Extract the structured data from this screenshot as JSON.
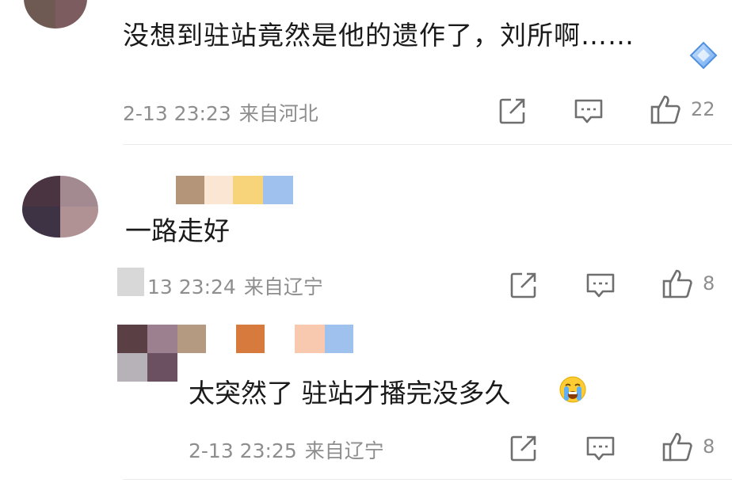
{
  "comments": [
    {
      "text": "没想到驻站竟然是他的遗作了，刘所啊……",
      "time": "2-13 23:23",
      "location": "来自河北",
      "likes": "22"
    },
    {
      "text": "一路走好",
      "time_visible": "13 23:24",
      "location": "来自辽宁",
      "likes": "8",
      "reply": {
        "text": "太突然了 驻站才播完没多久",
        "emoji": "crying-face",
        "time": "2-13 23:25",
        "location": "来自辽宁",
        "likes": "8"
      }
    }
  ],
  "icons": [
    "share-icon",
    "comment-icon",
    "thumbs-up-icon",
    "diamond-badge-icon"
  ],
  "colors": {
    "text": "#1a1a1a",
    "meta": "#8e8e8e",
    "divider": "#ececec",
    "icon": "#6f6f6f"
  }
}
